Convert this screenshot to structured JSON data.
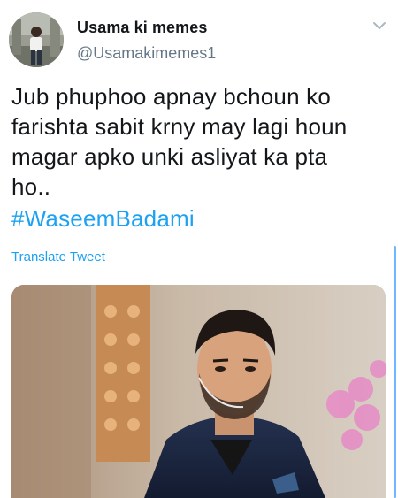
{
  "user": {
    "display_name": "Usama ki memes",
    "handle": "@Usamakimemes1",
    "avatar_icon": "profile-photo"
  },
  "menu": {
    "icon": "chevron-down-icon"
  },
  "tweet": {
    "lines": [
      "Jub phuphoo apnay bchoun ko",
      "farishta sabit krny may lagi houn",
      "magar apko unki asliyat ka pta",
      "ho.."
    ],
    "hashtag": "#WaseemBadami",
    "translate_label": "Translate Tweet"
  },
  "media": {
    "kind": "photo"
  },
  "colors": {
    "link": "#1da1f2",
    "text": "#14171a",
    "secondary": "#657786",
    "scroll_indicator": "#6fb7ff"
  }
}
